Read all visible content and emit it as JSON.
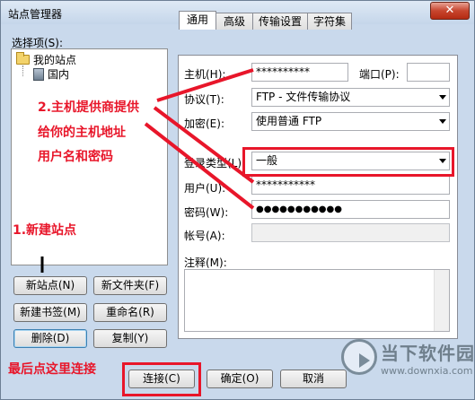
{
  "window": {
    "title": "站点管理器",
    "close_glyph": "✕"
  },
  "left": {
    "label": "选择项(S):",
    "tree": [
      {
        "label": "我的站点",
        "icon": "folder-icon"
      },
      {
        "label": "国内",
        "icon": "computer-icon"
      }
    ],
    "buttons": {
      "new_site": "新站点(N)",
      "new_folder": "新文件夹(F)",
      "new_bookmark": "新建书签(M)",
      "rename": "重命名(R)",
      "delete": "删除(D)",
      "copy": "复制(Y)"
    }
  },
  "tabs": [
    {
      "label": "通用",
      "active": true
    },
    {
      "label": "高级",
      "active": false
    },
    {
      "label": "传输设置",
      "active": false
    },
    {
      "label": "字符集",
      "active": false
    }
  ],
  "form": {
    "host": {
      "label": "主机(H):",
      "value": "**********"
    },
    "port": {
      "label": "端口(P):",
      "value": ""
    },
    "protocol": {
      "label": "协议(T):",
      "value": "FTP - 文件传输协议"
    },
    "encryption": {
      "label": "加密(E):",
      "value": "使用普通 FTP"
    },
    "logon_type": {
      "label": "登录类型(L):",
      "value": "一般"
    },
    "user": {
      "label": "用户(U):",
      "value": "***********"
    },
    "password": {
      "label": "密码(W):",
      "value": "●●●●●●●●●●●"
    },
    "account": {
      "label": "帐号(A):",
      "value": ""
    },
    "comments": {
      "label": "注释(M):",
      "value": ""
    }
  },
  "footer": {
    "connect": "连接(C)",
    "ok": "确定(O)",
    "cancel": "取消"
  },
  "annotations": {
    "step1": "1.新建站点",
    "step2_line1": "2.主机提供商提供",
    "step2_line2": "给你的主机地址",
    "step2_line3": "用户名和密码",
    "step3": "最后点这里连接"
  },
  "watermark": {
    "name": "当下软件园",
    "url": "www.downxia.com"
  },
  "colors": {
    "annotation_red": "#e8162a",
    "title_bar": "#c5d6ea"
  }
}
